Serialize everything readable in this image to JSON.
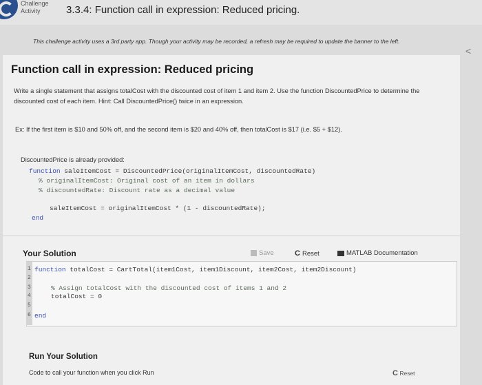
{
  "header": {
    "activity_type_line1": "Challenge",
    "activity_type_line2": "Activity",
    "title": "3.3.4: Function call in expression: Reduced pricing."
  },
  "notice": "This challenge activity uses a 3rd party app. Though your activity may be recorded, a refresh may be required to update the banner to the left.",
  "problem": {
    "title": "Function call in expression: Reduced pricing",
    "description": "Write a single statement that assigns totalCost with the discounted cost of item 1 and item 2. Use the function DiscountedPrice to determine the discounted cost of each item. Hint: Call DiscountedPrice() twice in an expression.",
    "example": "Ex: If the first item is $10 and 50% off, and the second item is $20 and 40% off, then totalCost is $17 (i.e. $5 + $12).",
    "provided_note": "DiscountedPrice is already provided:",
    "provided_code": {
      "line1_kw": "function",
      "line1_rest": " saleItemCost = DiscountedPrice(originalItemCost, discountedRate)",
      "line2": "% originalItemCost: Original cost of an item in dollars",
      "line3": "% discountedRate: Discount rate as a decimal value",
      "line4": "saleItemCost = originalItemCost * (1 - discountedRate);",
      "line5": "end"
    }
  },
  "solution": {
    "title": "Your Solution",
    "save_label": "Save",
    "reset_label": "Reset",
    "matlab_doc_label": "MATLAB Documentation",
    "line_numbers": [
      "1",
      "2",
      "3",
      "4",
      "5",
      "6"
    ],
    "code": {
      "line1_kw": "function",
      "line1_rest": " totalCost = CartTotal(item1Cost, item1Discount, item2Cost, item2Discount)",
      "line3": "% Assign totalCost with the discounted cost of items 1 and 2",
      "line4": "totalCost = 0",
      "line6": "end"
    }
  },
  "run": {
    "title": "Run Your Solution",
    "description": "Code to call your function when you click Run",
    "reset_label": "Reset"
  }
}
